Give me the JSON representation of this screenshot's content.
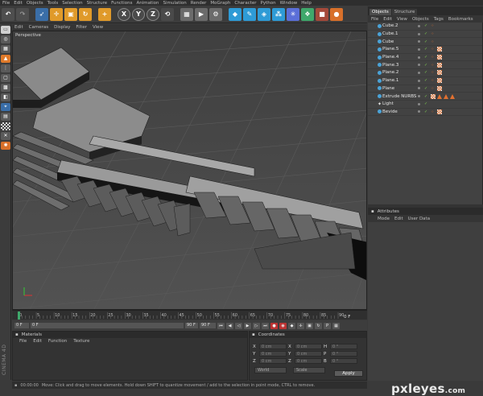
{
  "menubar": [
    "File",
    "Edit",
    "Objects",
    "Tools",
    "Selection",
    "Structure",
    "Functions",
    "Animation",
    "Simulation",
    "Render",
    "MoGraph",
    "Character",
    "Python",
    "Window",
    "Help"
  ],
  "toolbar": {
    "buttons": [
      "undo-icon",
      "redo-icon",
      "live-select-icon",
      "move-icon",
      "scale-icon",
      "rotate-icon",
      "add-icon",
      "x-axis",
      "y-axis",
      "z-axis",
      "coordinate-system-icon",
      "render-view-icon",
      "render-picture-viewer-icon",
      "render-settings-icon",
      "cube-icon",
      "pen-icon",
      "subdivision-icon",
      "array-icon",
      "deformer-icon",
      "scene-icon",
      "camera-icon",
      "light-icon"
    ],
    "axis_labels": [
      "X",
      "Y",
      "Z"
    ]
  },
  "viewport": {
    "menu": [
      "Edit",
      "Cameras",
      "Display",
      "Filter",
      "View"
    ],
    "label": "Perspective"
  },
  "timeline": {
    "ticks": [
      "0",
      "5",
      "10",
      "15",
      "20",
      "25",
      "30",
      "35",
      "40",
      "45",
      "50",
      "55",
      "60",
      "65",
      "70",
      "75",
      "80",
      "85",
      "90"
    ],
    "current_frame": "0 F",
    "start_field": "0 F",
    "end_field": "90 F",
    "max_field": "90 F"
  },
  "materials": {
    "title": "Materials",
    "menu": [
      "File",
      "Edit",
      "Function",
      "Texture"
    ]
  },
  "coordinates": {
    "title": "Coordinates",
    "rows": [
      {
        "a": "X",
        "a_val": "0 cm",
        "b": "X",
        "b_val": "0 cm",
        "c": "H",
        "c_val": "0 °"
      },
      {
        "a": "Y",
        "a_val": "0 cm",
        "b": "Y",
        "b_val": "0 cm",
        "c": "P",
        "c_val": "0 °"
      },
      {
        "a": "Z",
        "a_val": "0 cm",
        "b": "Z",
        "b_val": "0 cm",
        "c": "B",
        "c_val": "0 °"
      }
    ],
    "mode_select": "World",
    "scale_select": "Scale",
    "apply_label": "Apply"
  },
  "status": {
    "time": "00:00:00",
    "message": "Move: Click and drag to move elements. Hold down SHIFT to quantize movement / add to the selection in point mode, CTRL to remove."
  },
  "brand_label": "CINEMA 4D",
  "right_panel": {
    "tabs": [
      "Objects",
      "Structure"
    ],
    "menu": [
      "File",
      "Edit",
      "View",
      "Objects",
      "Tags",
      "Bookmarks"
    ],
    "objects": [
      {
        "name": "Cube.2",
        "icon_color": "#4aa3d8",
        "tags": "dots"
      },
      {
        "name": "Cube.1",
        "icon_color": "#4aa3d8",
        "tags": "dots"
      },
      {
        "name": "Cube",
        "icon_color": "#4aa3d8",
        "tags": "dots"
      },
      {
        "name": "Plane.5",
        "icon_color": "#4aa3d8",
        "tags": "dots-checker"
      },
      {
        "name": "Plane.4",
        "icon_color": "#4aa3d8",
        "tags": "dots-checker"
      },
      {
        "name": "Plane.3",
        "icon_color": "#4aa3d8",
        "tags": "dots-checker"
      },
      {
        "name": "Plane.2",
        "icon_color": "#4aa3d8",
        "tags": "dots-checker"
      },
      {
        "name": "Plane.1",
        "icon_color": "#4aa3d8",
        "tags": "dots-checker"
      },
      {
        "name": "Plane",
        "icon_color": "#4aa3d8",
        "tags": "dots-checker"
      },
      {
        "name": "Extrude NURBS",
        "icon_color": "#4aa3d8",
        "tags": "checker-tri"
      },
      {
        "name": "Light",
        "icon_color": "#e8e8e8",
        "tags": "none"
      },
      {
        "name": "Bevide",
        "icon_color": "#4aa3d8",
        "tags": "dots-checker"
      }
    ]
  },
  "attributes": {
    "title": "Attributes",
    "menu": [
      "Mode",
      "Edit",
      "User Data"
    ]
  },
  "watermark": {
    "text": "pxleyes",
    "domain": ".com"
  }
}
